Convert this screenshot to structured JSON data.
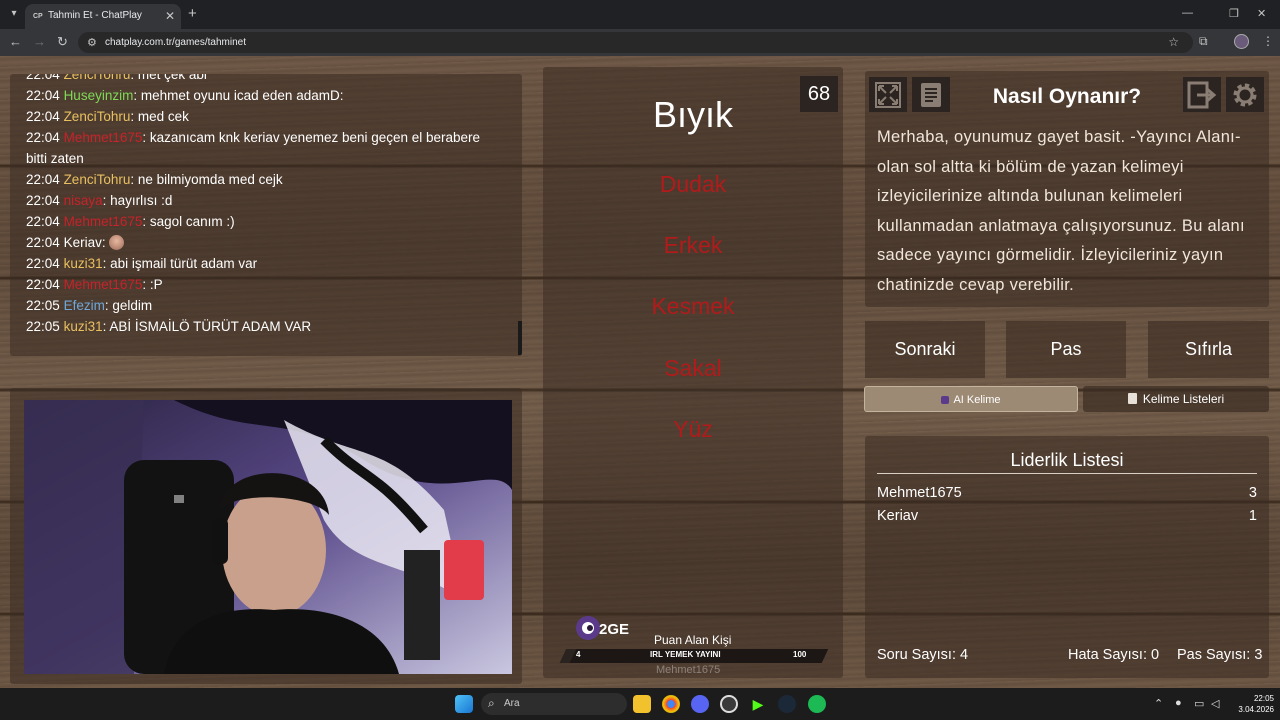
{
  "browser": {
    "tab_title": "Tahmin Et - ChatPlay",
    "favicon_text": "CP",
    "url": "chatplay.com.tr/games/tahminet"
  },
  "chat": {
    "messages": [
      {
        "time": "22:04",
        "user": "ZenciTohru",
        "color": "#e8c060",
        "text": ": met çek abi"
      },
      {
        "time": "22:04",
        "user": "Huseyinzim",
        "color": "#7ed957",
        "text": ": mehmet oyunu icad eden adamD:"
      },
      {
        "time": "22:04",
        "user": "ZenciTohru",
        "color": "#e8c060",
        "text": ": med cek"
      },
      {
        "time": "22:04",
        "user": "Mehmet1675",
        "color": "#c8222a",
        "text": ": kazanıcam knk keriav yenemez beni geçen el berabere bitti zaten"
      },
      {
        "time": "22:04",
        "user": "ZenciTohru",
        "color": "#e8c060",
        "text": ": ne bilmiyomda med cejk"
      },
      {
        "time": "22:04",
        "user": "nisaya",
        "color": "#c8222a",
        "text": ": hayırlısı :d"
      },
      {
        "time": "22:04",
        "user": "Mehmet1675",
        "color": "#c8222a",
        "text": ": sagol canım :)"
      },
      {
        "time": "22:04",
        "user": "Keriav",
        "color": "#ffffff",
        "text": ": "
      },
      {
        "time": "22:04",
        "user": "kuzi31",
        "color": "#e8c060",
        "text": ": abi işmail türüt adam var"
      },
      {
        "time": "22:04",
        "user": "Mehmet1675",
        "color": "#c8222a",
        "text": ": :P"
      },
      {
        "time": "22:05",
        "user": "Efezim",
        "color": "#6fa8dc",
        "text": ": geldim"
      },
      {
        "time": "22:05",
        "user": "kuzi31",
        "color": "#e8c060",
        "text": ": ABİ İSMAİLÖ TÜRÜT ADAM VAR"
      }
    ]
  },
  "game": {
    "timer": "68",
    "main_word": "Bıyık",
    "taboo_words": [
      "Dudak",
      "Erkek",
      "Kesmek",
      "Sakal",
      "Yüz"
    ],
    "score_label": "Puan Alan Kişi",
    "score_name": "Mehmet1675",
    "bar_text": "IRL YEMEK YAYINI",
    "bar_min": "4",
    "bar_max": "100",
    "bar_progress": 0.04,
    "logo_text": "2GE"
  },
  "howto": {
    "title": "Nasıl Oynanır?",
    "text": "Merhaba, oyunumuz gayet basit. -Yayıncı Alanı- olan sol altta ki bölüm de yazan kelimeyi izleyicilerinize altında bulunan kelimeleri kullanmadan anlatmaya çalışıyorsunuz. Bu alanı sadece yayıncı görmelidir. İzleyicileriniz yayın chatinizde cevap verebilir."
  },
  "controls": {
    "next": "Sonraki",
    "pass": "Pas",
    "reset": "Sıfırla",
    "ai_tab": "AI Kelime",
    "lists_tab": "Kelime Listeleri"
  },
  "leaderboard": {
    "title": "Liderlik Listesi",
    "rows": [
      {
        "name": "Mehmet1675",
        "score": "3"
      },
      {
        "name": "Keriav",
        "score": "1"
      }
    ],
    "question_count": "Soru Sayısı: 4",
    "error_count": "Hata Sayısı: 0",
    "pass_count": "Pas Sayısı: 3"
  },
  "taskbar": {
    "search_placeholder": "Ara",
    "time": "22:05",
    "date": "3.04.2026"
  }
}
